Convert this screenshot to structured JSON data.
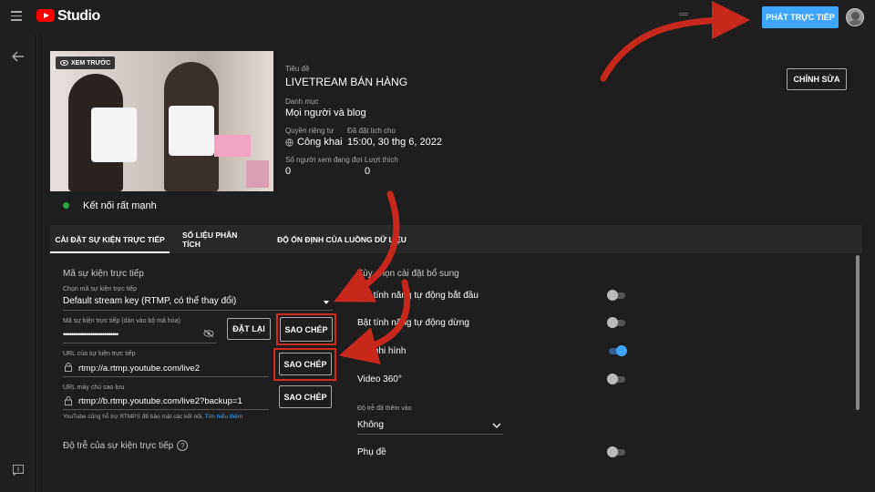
{
  "header": {
    "logo_text": "Studio",
    "go_live_label": "PHÁT TRỰC TIẾP",
    "menu_icon": "menu-icon",
    "avatar_icon": "avatar"
  },
  "preview": {
    "badge_label": "XEM TRƯỚC",
    "connection_status": "Kết nối rất mạnh",
    "status_color": "#2ba640"
  },
  "details": {
    "title_label": "Tiêu đề",
    "title_value": "LIVETREAM BÁN HÀNG",
    "category_label": "Danh mục",
    "category_value": "Mọi người và blog",
    "privacy_label": "Quyền riêng tư",
    "privacy_value": "Công khai",
    "scheduled_label": "Đã đặt lịch cho",
    "scheduled_value": "15:00, 30 thg 6, 2022",
    "waiting_label": "Số người xem đang đợi",
    "waiting_value": "0",
    "likes_label": "Lượt thích",
    "likes_value": "0",
    "edit_label": "CHỈNH SỬA"
  },
  "tabs": [
    {
      "label": "CÀI ĐẶT SỰ KIỆN TRỰC TIẾP"
    },
    {
      "label": "SỐ LIỆU PHÂN TÍCH"
    },
    {
      "label": "ĐỘ ỔN ĐỊNH CỦA LUỒNG DỮ LIỆU"
    }
  ],
  "stream_key": {
    "section_title": "Mã sự kiện trực tiếp",
    "select_label": "Chọn mã sự kiện trực tiếp",
    "select_value": "Default stream key (RTMP, có thể thay đổi)",
    "key_label": "Mã sự kiện trực tiếp (dán vào bộ mã hóa)",
    "key_value": "••••••••••••••••••••••••••••",
    "reset_label": "ĐẶT LẠI",
    "copy_label": "SAO CHÉP",
    "url_label": "URL của sự kiện trực tiếp",
    "url_value": "rtmp://a.rtmp.youtube.com/live2",
    "backup_label": "URL máy chủ sao lưu",
    "backup_value": "rtmp://b.rtmp.youtube.com/live2?backup=1",
    "rtmps_note": "YouTube cũng hỗ trợ RTMPS để bảo mật các kết nối.",
    "learn_more": "Tìm hiểu thêm",
    "latency_title": "Độ trễ của sự kiện trực tiếp"
  },
  "extra": {
    "section_title": "Tùy chọn cài đặt bổ sung",
    "autostart_label": "Bật tính năng tự động bắt đầu",
    "autostop_label": "Bật tính năng tự động dừng",
    "dvr_label": "Bật ghi hình",
    "video360_label": "Video 360°",
    "delay_label": "Độ trễ đã thêm vào",
    "delay_value": "Không",
    "captions_label": "Phụ đề"
  }
}
